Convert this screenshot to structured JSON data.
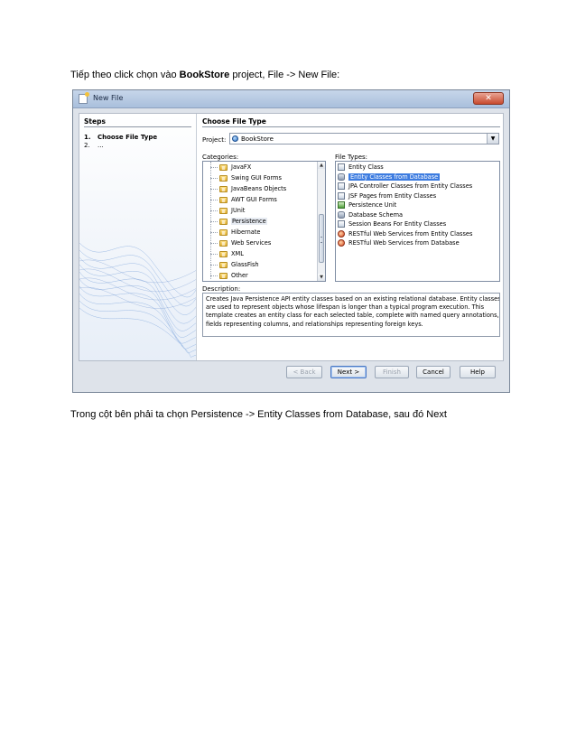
{
  "intro": {
    "prefix": "Tiếp theo click chọn vào ",
    "bold": "BookStore",
    "suffix": " project, File -> New File:"
  },
  "outro": "Trong cột bên phải ta chọn Persistence -> Entity Classes from Database, sau đó Next",
  "dialog": {
    "title": "New File",
    "close_label": "✕",
    "steps": {
      "heading": "Steps",
      "items": [
        {
          "num": "1.",
          "label": "Choose File Type"
        },
        {
          "num": "2.",
          "label": "..."
        }
      ]
    },
    "heading": "Choose File Type",
    "project_label": "Project:",
    "project_value": "BookStore",
    "categories_label": "Categories:",
    "categories": [
      "JavaFX",
      "Swing GUI Forms",
      "JavaBeans Objects",
      "AWT GUI Forms",
      "JUnit",
      "Persistence",
      "Hibernate",
      "Web Services",
      "XML",
      "GlassFish",
      "Other"
    ],
    "categories_selected": "Persistence",
    "file_types_label": "File Types:",
    "file_types": [
      {
        "label": "Entity Class",
        "icon": "class-icon"
      },
      {
        "label": "Entity Classes from Database",
        "icon": "database-icon"
      },
      {
        "label": "JPA Controller Classes from Entity Classes",
        "icon": "class-icon"
      },
      {
        "label": "JSF Pages from Entity Classes",
        "icon": "page-icon"
      },
      {
        "label": "Persistence Unit",
        "icon": "persistence-icon"
      },
      {
        "label": "Database Schema",
        "icon": "database-icon"
      },
      {
        "label": "Session Beans For Entity Classes",
        "icon": "bean-icon"
      },
      {
        "label": "RESTful Web Services from Entity Classes",
        "icon": "rest-icon"
      },
      {
        "label": "RESTful Web Services from Database",
        "icon": "rest-icon"
      }
    ],
    "file_types_selected": "Entity Classes from Database",
    "description_label": "Description:",
    "description_lines": [
      "Creates Java Persistence API entity classes based on an existing relational database. Entity classes",
      "are used to represent objects whose lifespan is longer than a typical program execution. This",
      "template creates an entity class for each selected table, complete with named query annotations,",
      "fields representing columns, and relationships representing foreign keys."
    ],
    "buttons": {
      "back": "< Back",
      "next": "Next >",
      "finish": "Finish",
      "cancel": "Cancel",
      "help": "Help"
    },
    "colors": {
      "selection": "#3d7ce0",
      "title_bar": "#b9cbe3",
      "close": "#c84a2e"
    }
  }
}
